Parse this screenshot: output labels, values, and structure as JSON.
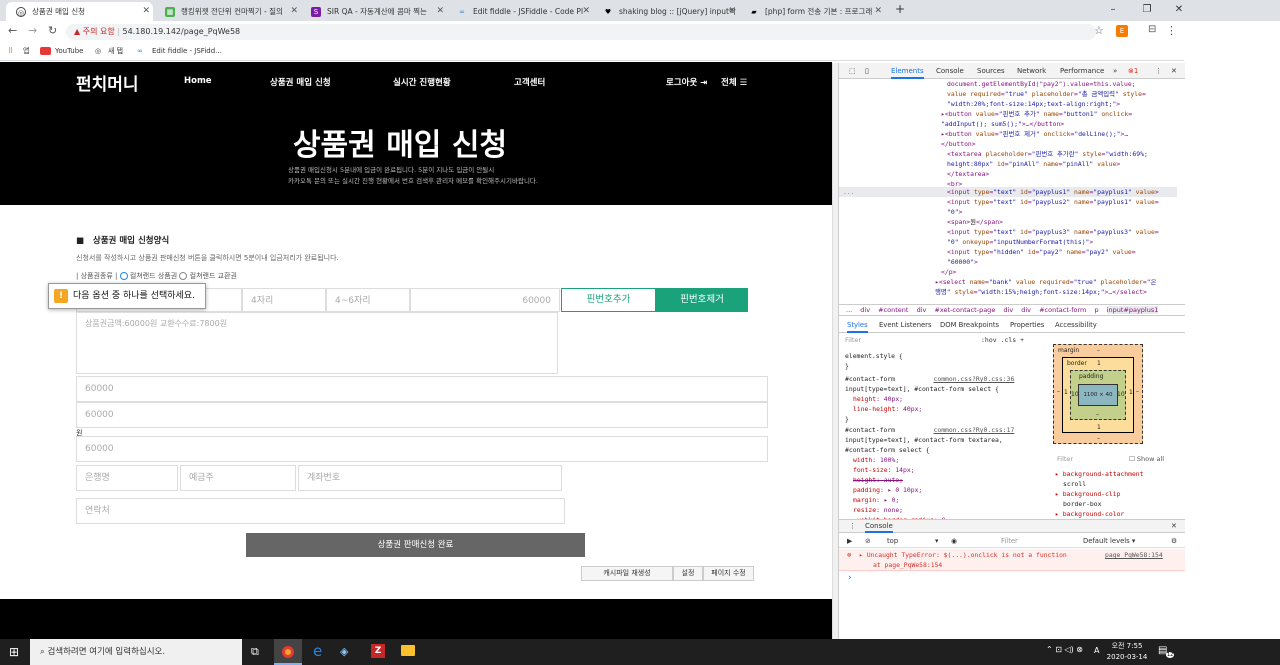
{
  "browser": {
    "tabs": [
      {
        "title": "상품권 매입 신청",
        "active": true
      },
      {
        "title": "랭킹위젯 전단위 컨마찍기 - 질의"
      },
      {
        "title": "SIR QA - 자동계산에 콤마 찍는"
      },
      {
        "title": "Edit fiddle - JSFiddle - Code Pl"
      },
      {
        "title": "shaking blog :: [jQuery] input박"
      },
      {
        "title": "[php] form 전송 기본 : 프로그래"
      }
    ],
    "new_tab": "+",
    "security": "주의 요함",
    "url": "54.180.19.142/page_PqWe58",
    "bookmarks": [
      "앱",
      "YouTube",
      "새 탭",
      "Edit fiddle - JSFidd..."
    ]
  },
  "site": {
    "logo": "펀치머니",
    "nav": [
      "Home",
      "상품권 매입 신청",
      "실시간 진행현황",
      "고객센터"
    ],
    "nav_right": [
      "로그아웃",
      "전체"
    ],
    "hero_title": "상품권 매입 신청",
    "hero_sub": [
      "상품권 매입신청시 5분내에 입금이 완료됩니다. 5분이 지나도 입금이 안될시",
      "카카오톡 문의 또는 실시간 진행 현황에서 번호 검색후 관리자 메모를 확인해주시기바랍니다."
    ],
    "form": {
      "heading": "상품권 매입 신청양식",
      "desc": "신청서를 작성하시고 상품권 판매신청 버튼을 클릭하시면 5분이내 입금처리가 완료됩니다.",
      "type_label": "| 상품권종류 |",
      "radio1": "컬쳐랜드 상품권",
      "radio2": "컬쳐랜드 교환권",
      "tooltip": "다음 옵션 중 하나를 선택하세요.",
      "pin2_placeholder": "4자리",
      "pin3_placeholder": "4~6자리",
      "pin_amount": "60000",
      "add_pin": "핀번호추가",
      "remove_pin": "핀번호제거",
      "textarea_placeholder": "상품권금액:60000원   교환수수료:7800원",
      "field1": "60000",
      "field2": "60000",
      "won": "원",
      "field3": "60000",
      "bank_placeholder": "은행명",
      "holder_placeholder": "예금주",
      "account_placeholder": "계좌번호",
      "contact_placeholder": "연락처",
      "submit": "상품권 판매신청 완료"
    },
    "admin_buttons": [
      "캐시파일 재생성",
      "설정",
      "페이지 수정"
    ]
  },
  "devtools": {
    "tabs": [
      "Elements",
      "Console",
      "Sources",
      "Network",
      "Performance"
    ],
    "more": "»",
    "error_count": "1",
    "breadcrumb": [
      "...",
      "div",
      "#content",
      "div",
      "#xet-contact-page",
      "div",
      "div",
      "#contact-form",
      "p",
      "input#payplus1"
    ],
    "style_tabs": [
      "Styles",
      "Event Listeners",
      "DOM Breakpoints",
      "Properties",
      "Accessibility"
    ],
    "filter": "Filter",
    "hov_cls": ":hov  .cls  +",
    "box": {
      "margin": "margin",
      "border": "border",
      "padding": "padding",
      "content": "1100 × 40",
      "dash": "–",
      "side1": "1",
      "side10": "10"
    },
    "computed_filter": "Filter",
    "show_all": "Show all",
    "computed": [
      "background-attachment",
      "scroll",
      "background-clip",
      "border-box",
      "background-color"
    ],
    "console": {
      "title": "Console",
      "context": "top",
      "filter": "Filter",
      "levels": "Default levels ▾",
      "error": "Uncaught TypeError: $(...).onclick is not a function",
      "at": "at page_PqWe58:154",
      "source": "page_PqWe58:154",
      "prompt": "›"
    }
  },
  "taskbar": {
    "search": "검색하려면 여기에 입력하십시오.",
    "time": "오전 7:55",
    "date": "2020-03-14",
    "lang": "A",
    "notif": "12"
  }
}
